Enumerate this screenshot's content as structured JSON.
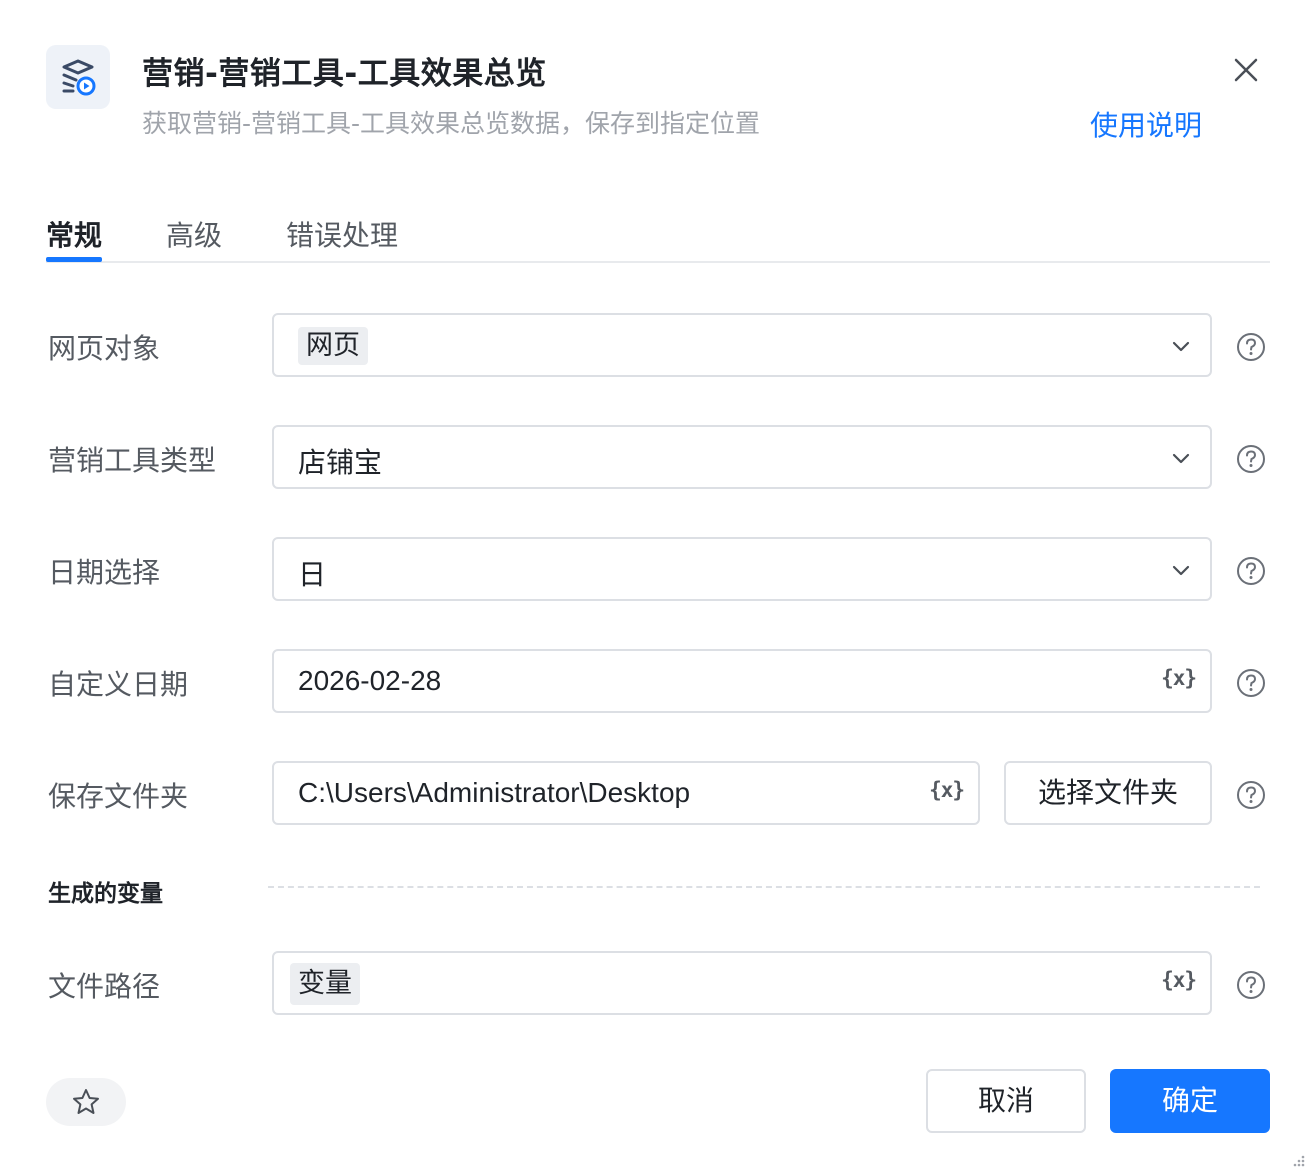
{
  "header": {
    "icon": "web-data-icon",
    "title": "营销-营销工具-工具效果总览",
    "subtitle": "获取营销-营销工具-工具效果总览数据，保存到指定位置",
    "help_link": "使用说明",
    "close_icon": "close-icon"
  },
  "tabs": [
    {
      "label": "常规",
      "active": true
    },
    {
      "label": "高级",
      "active": false
    },
    {
      "label": "错误处理",
      "active": false
    }
  ],
  "form": {
    "web_object": {
      "label": "网页对象",
      "value": "网页"
    },
    "tool_type": {
      "label": "营销工具类型",
      "value": "店铺宝"
    },
    "date_select": {
      "label": "日期选择",
      "value": "日"
    },
    "custom_date": {
      "label": "自定义日期",
      "value": "2026-02-28",
      "var_icon": "{x}"
    },
    "save_folder": {
      "label": "保存文件夹",
      "value": "C:\\Users\\Administrator\\Desktop",
      "var_icon": "{x}",
      "button": "选择文件夹"
    }
  },
  "generated_vars": {
    "section_title": "生成的变量",
    "file_path": {
      "label": "文件路径",
      "value": "变量",
      "var_icon": "{x}"
    }
  },
  "footer": {
    "star_icon": "star-icon",
    "cancel": "取消",
    "confirm": "确定"
  },
  "colors": {
    "accent": "#1677ff",
    "border": "#dcdfe4",
    "label": "#555a61"
  }
}
